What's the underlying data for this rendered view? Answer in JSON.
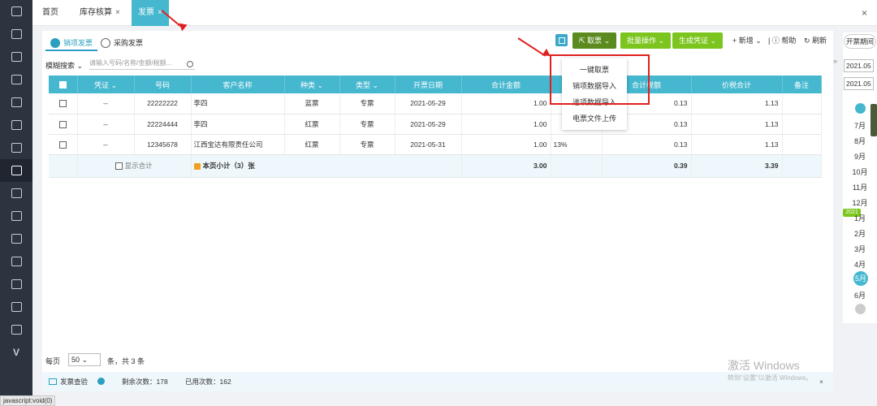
{
  "tabs": [
    {
      "label": "首页",
      "closable": false
    },
    {
      "label": "库存核算",
      "closable": true
    },
    {
      "label": "发票",
      "closable": true,
      "active": true
    }
  ],
  "close_glyph": "×",
  "subtabs": [
    {
      "label": "销项发票",
      "selected": true
    },
    {
      "label": "采购发票",
      "selected": false
    }
  ],
  "toolbar": {
    "fetch": "取票",
    "batch": "批量操作",
    "voucher": "生成凭证",
    "add": "新增",
    "help": "帮助",
    "refresh": "刷新"
  },
  "dropdown_items": [
    "一键取票",
    "销项数据导入",
    "进项数据导入",
    "电票文件上传"
  ],
  "filter": {
    "label": "模糊搜索",
    "placeholder": "请输入号码/名称/金额/税额..."
  },
  "table": {
    "headers": [
      "",
      "凭证",
      "号码",
      "客户名称",
      "种类",
      "类型",
      "开票日期",
      "合计金额",
      "税率",
      "合计税额",
      "价税合计",
      "备注"
    ],
    "rows": [
      {
        "voucher": "--",
        "number": "22222222",
        "customer": "李四",
        "kind": "蓝票",
        "type": "专票",
        "date": "2021-05-29",
        "amount": "1.00",
        "rate": "",
        "tax": "0.13",
        "total": "1.13",
        "note": ""
      },
      {
        "voucher": "--",
        "number": "22224444",
        "customer": "李四",
        "kind": "红票",
        "type": "专票",
        "date": "2021-05-29",
        "amount": "1.00",
        "rate": "",
        "tax": "0.13",
        "total": "1.13",
        "note": ""
      },
      {
        "voucher": "--",
        "number": "12345678",
        "customer": "江西宝达有限责任公司",
        "kind": "红票",
        "type": "专票",
        "date": "2021-05-31",
        "amount": "1.00",
        "rate": "13%",
        "tax": "0.13",
        "total": "1.13",
        "note": ""
      }
    ],
    "summary": {
      "show_total": "显示合计",
      "subtotal": "本页小计（3）张",
      "amount": "3.00",
      "tax": "0.39",
      "total": "3.39"
    }
  },
  "pager": {
    "per_page_label": "每页",
    "per_page": "50",
    "count_text": "条，共 3 条"
  },
  "footer": {
    "check": "发票查验",
    "remaining_label": "剩余次数：",
    "remaining": "178",
    "used_label": "已用次数：",
    "used": "162"
  },
  "calendar": {
    "button": "开票期间",
    "date_from": "2021.05",
    "date_to": "2021.05",
    "months": [
      "7月",
      "8月",
      "9月",
      "10月",
      "11月",
      "12月",
      "1月",
      "2月",
      "3月",
      "4月",
      "5月",
      "6月"
    ],
    "year": "2021",
    "selected_month": "5月"
  },
  "watermark": {
    "line1": "激活 Windows",
    "line2": "转到\"设置\"以激活 Windows。"
  },
  "status_url": "javascript:void(0)",
  "colors": {
    "accent": "#45b7cf",
    "dark_green": "#5b8b1f",
    "light_green": "#7cc51f",
    "highlight_red": "#e02020",
    "sidebar": "#2c3440"
  }
}
